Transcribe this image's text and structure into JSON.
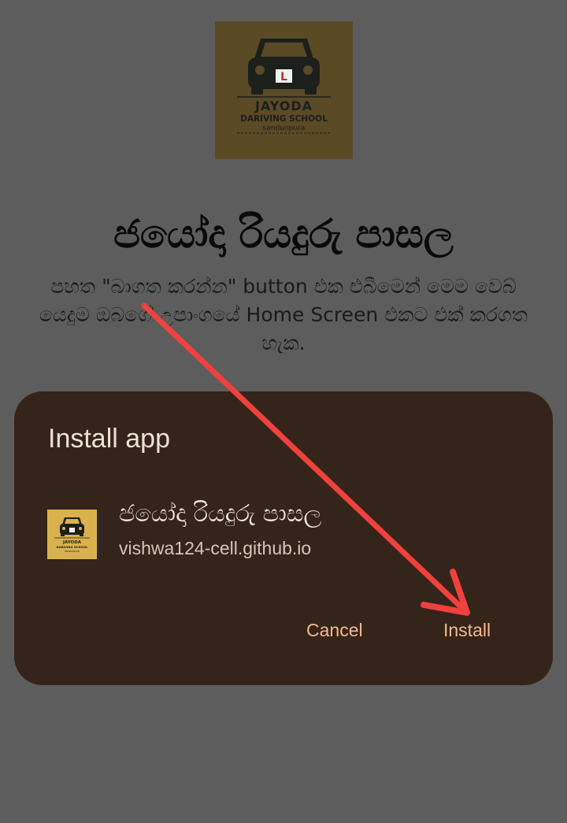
{
  "logo": {
    "name": "JAYODA",
    "line2": "DARIVING SCHOOL",
    "line3": "sandunpura",
    "plate_letter": "L"
  },
  "page": {
    "title": "ජයෝදා රියදුරු පාසල",
    "description": "පහත \"බාගත කරන්න\" button එක එබීමෙන් මෙම වෙබ් යෙදුම ඔබගේ උපාංගයේ Home Screen එකට එක් කරගත හැක."
  },
  "dialog": {
    "title": "Install app",
    "app_name": "ජයෝදා රියදුරු පාසල",
    "app_url": "vishwa124-cell.github.io",
    "cancel_label": "Cancel",
    "install_label": "Install"
  },
  "colors": {
    "background": "#5d5d5d",
    "dialog": "#35241a",
    "button_text": "#f4b98d",
    "arrow": "#f0413e",
    "logo_bg": "#5a4a25",
    "app_icon_bg": "#d9b24d"
  },
  "icons": {
    "logo": "car-icon",
    "annotation": "arrow-icon"
  }
}
